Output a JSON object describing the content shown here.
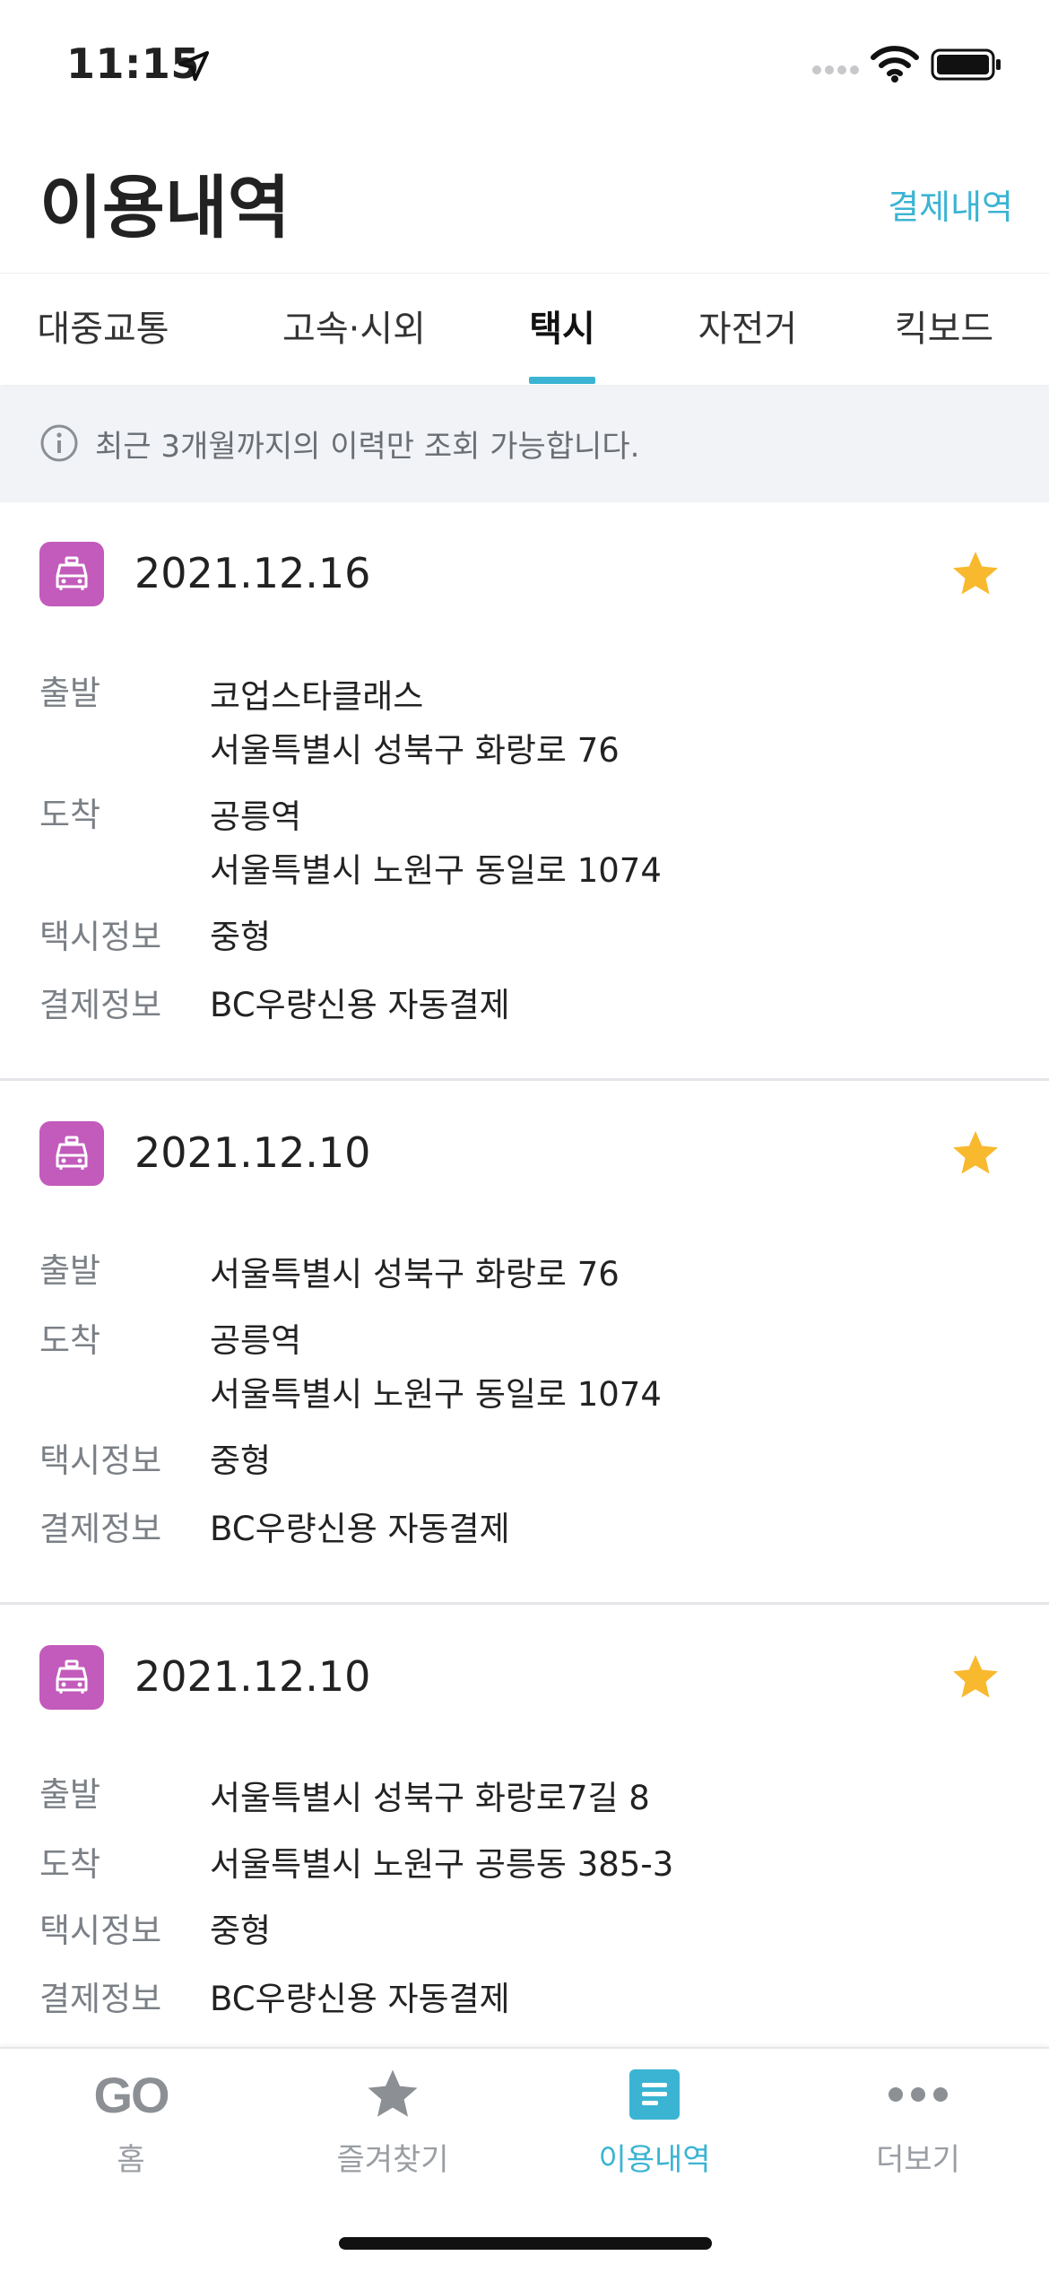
{
  "status_bar": {
    "time": "11:15"
  },
  "header": {
    "title": "이용내역",
    "payment_link": "결제내역"
  },
  "tabs": [
    {
      "label": "대중교통"
    },
    {
      "label": "고속·시외"
    },
    {
      "label": "택시"
    },
    {
      "label": "자전거"
    },
    {
      "label": "킥보드"
    }
  ],
  "active_tab": "택시",
  "notice": {
    "text": "최근 3개월까지의 이력만 조회 가능합니다."
  },
  "labels": {
    "departure": "출발",
    "arrival": "도착",
    "taxi_info": "택시정보",
    "payment_info": "결제정보"
  },
  "records": [
    {
      "date": "2021.12.16",
      "departure_name": "코업스타클래스",
      "departure_address": "서울특별시 성북구 화랑로 76",
      "arrival_name": "공릉역",
      "arrival_address": "서울특별시 노원구 동일로 1074",
      "taxi_info": "중형",
      "payment_info": "BC우량신용 자동결제"
    },
    {
      "date": "2021.12.10",
      "departure_address": "서울특별시 성북구 화랑로 76",
      "arrival_name": "공릉역",
      "arrival_address": "서울특별시 노원구 동일로 1074",
      "taxi_info": "중형",
      "payment_info": "BC우량신용 자동결제"
    },
    {
      "date": "2021.12.10",
      "departure_address": "서울특별시 성북구 화랑로7길 8",
      "arrival_address": "서울특별시 노원구 공릉동 385-3",
      "taxi_info": "중형",
      "payment_info": "BC우량신용 자동결제"
    }
  ],
  "bottom_nav": [
    {
      "label": "홈",
      "icon": "go-logo-icon",
      "icon_text": "GO"
    },
    {
      "label": "즐겨찾기",
      "icon": "star-icon"
    },
    {
      "label": "이용내역",
      "icon": "history-list-icon",
      "active": true
    },
    {
      "label": "더보기",
      "icon": "more-dots-icon"
    }
  ],
  "colors": {
    "accent": "#3bb4d3",
    "taxi_badge": "#c25bbb",
    "star": "#f8b92f",
    "muted": "#7b8086"
  }
}
